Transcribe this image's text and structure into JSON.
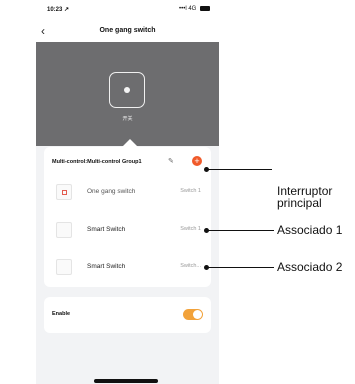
{
  "status_bar": {
    "time": "10:23 ↗",
    "signal": "•••l 4G"
  },
  "nav": {
    "back_icon": "chevron-left-icon",
    "title": "One gang switch"
  },
  "hero": {
    "tile_label": "开关"
  },
  "group": {
    "name": "Multi-control:Multi-control Group1",
    "rows": [
      {
        "name": "One gang switch",
        "switch": "Switch 1"
      },
      {
        "name": "Smart Switch",
        "switch": "Switch 1"
      },
      {
        "name": "Smart Switch",
        "switch": "Switch..."
      }
    ]
  },
  "enable": {
    "label": "Enable",
    "on": true
  },
  "annotations": [
    {
      "text": "Interruptor\nprincipal"
    },
    {
      "text": "Associado 1"
    },
    {
      "text": "Associado 2"
    }
  ],
  "colors": {
    "accent": "#f2a23a",
    "add": "#f05a2a",
    "hero": "#6d6d6f"
  }
}
